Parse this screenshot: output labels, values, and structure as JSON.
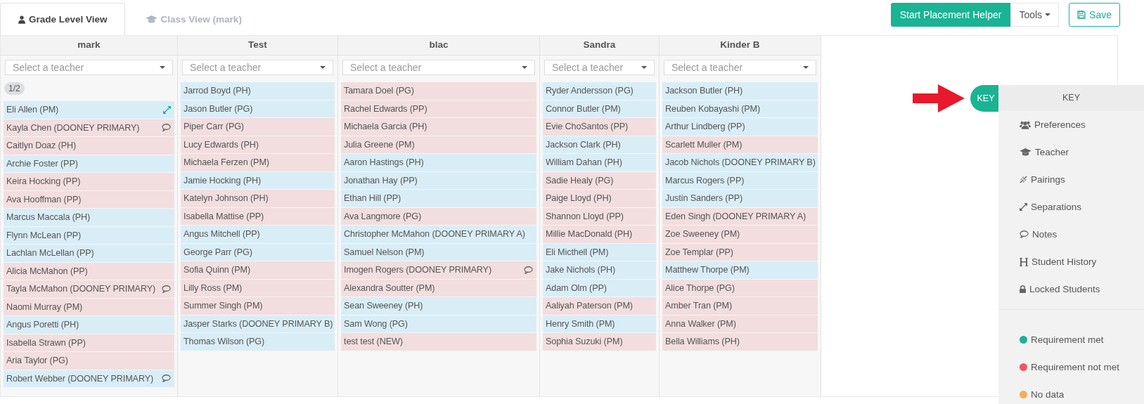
{
  "tabs": [
    {
      "label": "Grade Level View",
      "kind": "user",
      "selected": true
    },
    {
      "label": "Class View (mark)",
      "kind": "grad",
      "selected": false
    }
  ],
  "toolbar": {
    "primary": "Start Placement Helper",
    "tools": "Tools",
    "save": "Save"
  },
  "columns": [
    {
      "name": "mark",
      "placeholder": "Select a teacher",
      "badge": "1/2",
      "students": [
        {
          "name": "Eli Allen (PM)",
          "color": "#d9edf7",
          "kind": "separation"
        },
        {
          "name": "Kayla Chen (DOONEY PRIMARY)",
          "color": "#f2dede",
          "kind": "notes"
        },
        {
          "name": "Caitlyn Doaz (PH)",
          "color": "#f2dede"
        },
        {
          "name": "Archie Foster (PP)",
          "color": "#d9edf7"
        },
        {
          "name": "Keira Hocking (PP)",
          "color": "#f2dede"
        },
        {
          "name": "Ava Hooffman (PP)",
          "color": "#f2dede"
        },
        {
          "name": "Marcus Maccala (PH)",
          "color": "#d9edf7"
        },
        {
          "name": "Flynn McLean (PP)",
          "color": "#d9edf7"
        },
        {
          "name": "Lachlan McLellan (PP)",
          "color": "#d9edf7"
        },
        {
          "name": "Alicia McMahon (PP)",
          "color": "#f2dede"
        },
        {
          "name": "Tayla McMahon (DOONEY PRIMARY)",
          "color": "#f2dede",
          "kind": "notes"
        },
        {
          "name": "Naomi Murray (PM)",
          "color": "#f2dede"
        },
        {
          "name": "Angus Poretti (PH)",
          "color": "#d9edf7"
        },
        {
          "name": "Isabella Strawn (PP)",
          "color": "#f2dede"
        },
        {
          "name": "Aria Taylor (PG)",
          "color": "#f2dede"
        },
        {
          "name": "Robert Webber (DOONEY PRIMARY)",
          "color": "#d9edf7",
          "kind": "notes"
        }
      ]
    },
    {
      "name": "Test",
      "placeholder": "Select a teacher",
      "students": [
        {
          "name": "Jarrod Boyd (PH)",
          "color": "#d9edf7"
        },
        {
          "name": "Jason Butler (PG)",
          "color": "#d9edf7"
        },
        {
          "name": "Piper Carr (PG)",
          "color": "#f2dede"
        },
        {
          "name": "Lucy Edwards (PH)",
          "color": "#f2dede"
        },
        {
          "name": "Michaela Ferzen (PM)",
          "color": "#f2dede"
        },
        {
          "name": "Jamie Hocking (PH)",
          "color": "#d9edf7"
        },
        {
          "name": "Katelyn Johnson (PH)",
          "color": "#f2dede"
        },
        {
          "name": "Isabella Mattise (PP)",
          "color": "#f2dede"
        },
        {
          "name": "Angus Mitchell (PP)",
          "color": "#d9edf7"
        },
        {
          "name": "George Parr (PG)",
          "color": "#d9edf7"
        },
        {
          "name": "Sofia Quinn (PM)",
          "color": "#f2dede"
        },
        {
          "name": "Lilly Ross (PM)",
          "color": "#f2dede"
        },
        {
          "name": "Summer Singh (PM)",
          "color": "#f2dede"
        },
        {
          "name": "Jasper Starks (DOONEY PRIMARY B)",
          "color": "#d9edf7"
        },
        {
          "name": "Thomas Wilson (PG)",
          "color": "#d9edf7"
        }
      ]
    },
    {
      "name": "blac",
      "placeholder": "Select a teacher",
      "students": [
        {
          "name": "Tamara Doel (PG)",
          "color": "#f2dede"
        },
        {
          "name": "Rachel Edwards (PP)",
          "color": "#f2dede"
        },
        {
          "name": "Michaela Garcia (PH)",
          "color": "#f2dede"
        },
        {
          "name": "Julia Greene (PM)",
          "color": "#f2dede"
        },
        {
          "name": "Aaron Hastings (PH)",
          "color": "#d9edf7"
        },
        {
          "name": "Jonathan Hay (PP)",
          "color": "#d9edf7"
        },
        {
          "name": "Ethan Hill (PP)",
          "color": "#d9edf7"
        },
        {
          "name": "Ava Langmore (PG)",
          "color": "#f2dede"
        },
        {
          "name": "Christopher McMahon (DOONEY PRIMARY A)",
          "color": "#d9edf7"
        },
        {
          "name": "Samuel Nelson (PM)",
          "color": "#d9edf7"
        },
        {
          "name": "Imogen Rogers (DOONEY PRIMARY)",
          "color": "#f2dede",
          "kind": "notes"
        },
        {
          "name": "Alexandra Soutter (PM)",
          "color": "#f2dede"
        },
        {
          "name": "Sean Sweeney (PH)",
          "color": "#d9edf7"
        },
        {
          "name": "Sam Wong (PG)",
          "color": "#d9edf7"
        },
        {
          "name": "test test (NEW)",
          "color": "#f2dede"
        }
      ]
    },
    {
      "name": "Sandra",
      "placeholder": "Select a teacher",
      "students": [
        {
          "name": "Ryder Andersson (PG)",
          "color": "#d9edf7"
        },
        {
          "name": "Connor Butler (PM)",
          "color": "#d9edf7"
        },
        {
          "name": "Evie ChoSantos (PP)",
          "color": "#f2dede"
        },
        {
          "name": "Jackson Clark (PH)",
          "color": "#d9edf7"
        },
        {
          "name": "William Dahan (PH)",
          "color": "#d9edf7"
        },
        {
          "name": "Sadie Healy (PG)",
          "color": "#f2dede"
        },
        {
          "name": "Paige Lloyd (PH)",
          "color": "#f2dede"
        },
        {
          "name": "Shannon Lloyd (PP)",
          "color": "#f2dede"
        },
        {
          "name": "Millie MacDonald (PH)",
          "color": "#f2dede"
        },
        {
          "name": "Eli Micthell (PM)",
          "color": "#d9edf7"
        },
        {
          "name": "Jake Nichols (PH)",
          "color": "#d9edf7"
        },
        {
          "name": "Adam Olm (PP)",
          "color": "#d9edf7"
        },
        {
          "name": "Aaliyah Paterson (PM)",
          "color": "#f2dede"
        },
        {
          "name": "Henry Smith (PM)",
          "color": "#d9edf7"
        },
        {
          "name": "Sophia Suzuki (PM)",
          "color": "#f2dede"
        }
      ]
    },
    {
      "name": "Kinder B",
      "placeholder": "Select a teacher",
      "students": [
        {
          "name": "Jackson Butler (PH)",
          "color": "#d9edf7"
        },
        {
          "name": "Reuben Kobayashi (PM)",
          "color": "#d9edf7"
        },
        {
          "name": "Arthur Lindberg (PP)",
          "color": "#d9edf7"
        },
        {
          "name": "Scarlett Muller (PM)",
          "color": "#f2dede"
        },
        {
          "name": "Jacob Nichols (DOONEY PRIMARY B)",
          "color": "#d9edf7"
        },
        {
          "name": "Marcus Rogers (PP)",
          "color": "#d9edf7"
        },
        {
          "name": "Justin Sanders (PP)",
          "color": "#d9edf7"
        },
        {
          "name": "Eden Singh (DOONEY PRIMARY A)",
          "color": "#f2dede"
        },
        {
          "name": "Zoe Sweeney (PM)",
          "color": "#f2dede"
        },
        {
          "name": "Zoe Templar (PP)",
          "color": "#f2dede"
        },
        {
          "name": "Matthew Thorpe (PM)",
          "color": "#d9edf7"
        },
        {
          "name": "Alice Thorpe (PG)",
          "color": "#f2dede"
        },
        {
          "name": "Amber Tran (PM)",
          "color": "#f2dede"
        },
        {
          "name": "Anna Walker (PM)",
          "color": "#f2dede"
        },
        {
          "name": "Bella Williams (PH)",
          "color": "#f2dede"
        }
      ]
    }
  ],
  "key": {
    "toggle": "KEY",
    "title": "KEY",
    "items": [
      {
        "label": "Preferences",
        "kind": "users"
      },
      {
        "label": "Teacher",
        "kind": "grad"
      },
      {
        "label": "Pairings",
        "kind": "pairing"
      },
      {
        "label": "Separations",
        "kind": "separation"
      },
      {
        "label": "Notes",
        "kind": "notes"
      },
      {
        "label": "Student History",
        "kind": "history"
      },
      {
        "label": "Locked Students",
        "kind": "lock"
      }
    ],
    "legend": [
      {
        "label": "Requirement met",
        "color": "#1ab394"
      },
      {
        "label": "Requirement not met",
        "color": "#ed5565"
      },
      {
        "label": "No data",
        "color": "#f8ac59"
      }
    ]
  }
}
